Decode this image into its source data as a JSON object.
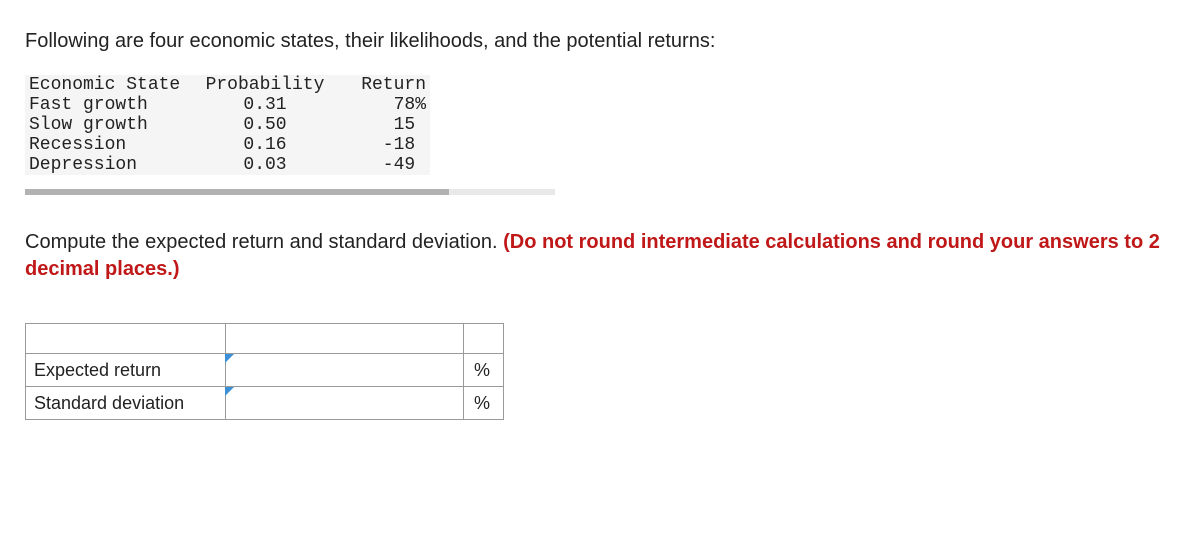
{
  "intro": "Following are four economic states, their likelihoods, and the potential returns:",
  "table": {
    "headers": {
      "state": "Economic State",
      "prob": "Probability",
      "return": "Return"
    },
    "rows": [
      {
        "state": "Fast growth",
        "prob": "0.31",
        "return": "78%"
      },
      {
        "state": "Slow growth",
        "prob": "0.50",
        "return": "15 "
      },
      {
        "state": "Recession",
        "prob": "0.16",
        "return": "-18 "
      },
      {
        "state": "Depression",
        "prob": "0.03",
        "return": "-49 "
      }
    ]
  },
  "instruction": {
    "lead": "Compute the expected return and standard deviation. ",
    "warn": "(Do not round intermediate calculations and round your answers to 2 decimal places.)"
  },
  "answers": {
    "rows": [
      {
        "label": "Expected return",
        "unit": "%"
      },
      {
        "label": "Standard deviation",
        "unit": "%"
      }
    ]
  }
}
